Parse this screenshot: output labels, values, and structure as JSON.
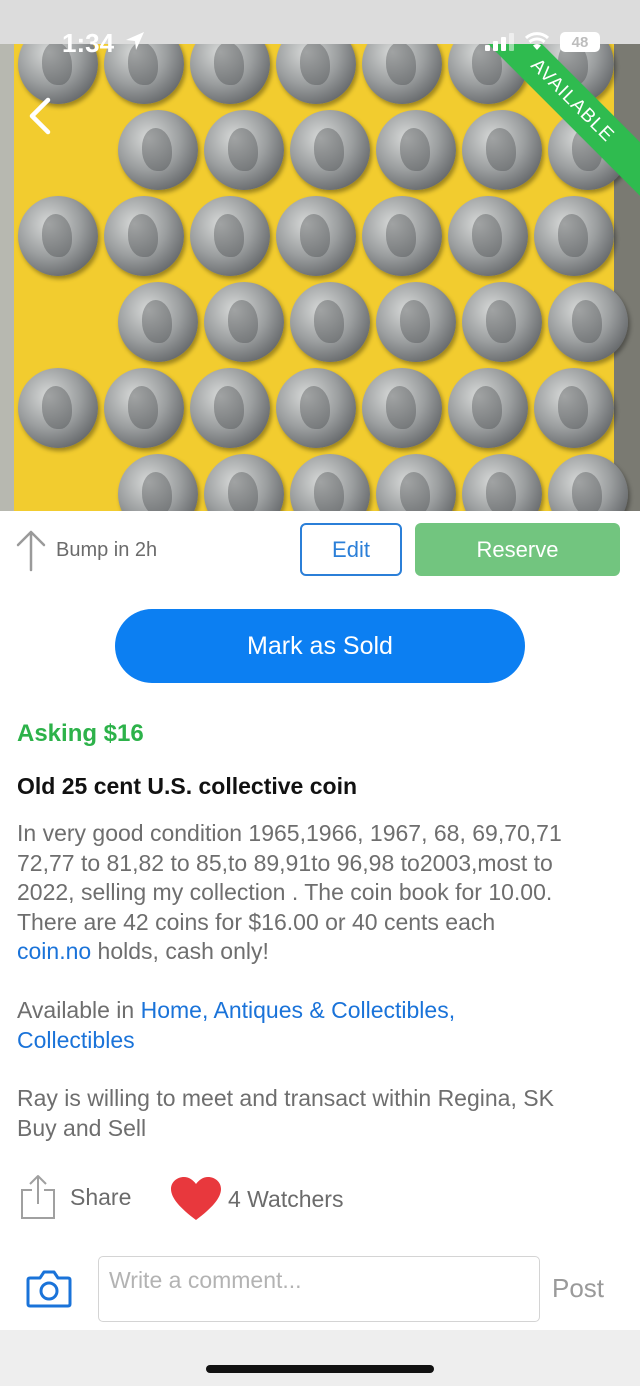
{
  "status_bar": {
    "time": "1:34",
    "battery": "48",
    "icons": [
      "location-arrow-icon",
      "cellular-signal-icon",
      "wifi-icon",
      "battery-icon"
    ]
  },
  "hero": {
    "badge": "AVAILABLE",
    "badge_color": "#2fbb4f",
    "background_color": "#f2cc2f"
  },
  "actions": {
    "bump_label": "Bump in 2h",
    "edit_label": "Edit",
    "reserve_label": "Reserve",
    "mark_sold_label": "Mark as Sold"
  },
  "listing": {
    "asking": "Asking $16",
    "title": "Old 25 cent U.S. collective coin",
    "description_lines": [
      "In very good condition 1965,1966, 1967, 68, 69,70,71",
      "72,77 to 81,82 to 85,to 89,91to 96,98 to2003,most to",
      "2022, selling my collection . The coin book for 10.00.",
      "There are 42 coins for $16.00 or  40 cents each"
    ],
    "description_link": "coin.no",
    "description_tail": " holds, cash only!",
    "category_prefix": "Available in ",
    "category_link_1": "Home, Antiques & Collectibles,",
    "category_link_2": "Collectibles",
    "meet_line_1": "Ray is willing to meet and transact within Regina, SK",
    "meet_line_2": "Buy and Sell"
  },
  "social": {
    "share_label": "Share",
    "watchers_label": "4 Watchers",
    "heart_color": "#e8383d"
  },
  "comment": {
    "placeholder": "Write a comment...",
    "post_label": "Post"
  },
  "colors": {
    "accent_blue": "#0c7ff2",
    "link_blue": "#1a73d9",
    "asking_green": "#2db24a",
    "reserve_green": "#72c57f"
  }
}
